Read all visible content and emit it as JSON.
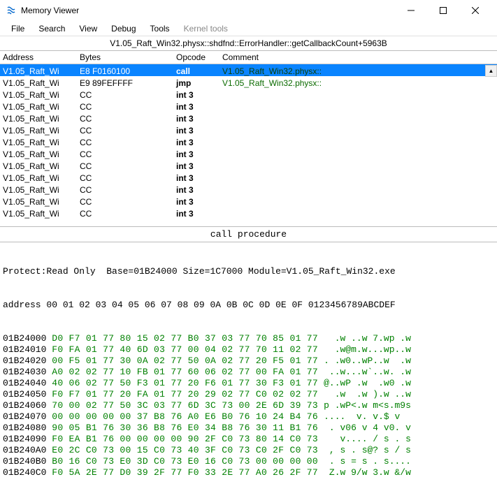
{
  "window": {
    "title": "Memory Viewer"
  },
  "menu": {
    "items": [
      "File",
      "Search",
      "View",
      "Debug",
      "Tools",
      "Kernel tools"
    ]
  },
  "context": "V1.05_Raft_Win32.physx::shdfnd::ErrorHandler::getCallbackCount+5963B",
  "headers": {
    "addr": "Address",
    "bytes": "Bytes",
    "op": "Opcode",
    "comment": "Comment"
  },
  "disasm": [
    {
      "addr": "V1.05_Raft_Wi",
      "bytes": "E8 F0160100",
      "op": "call",
      "comment": "V1.05_Raft_Win32.physx::",
      "selected": true
    },
    {
      "addr": "V1.05_Raft_Wi",
      "bytes": "E9 89FEFFFF",
      "op": "jmp",
      "comment": "V1.05_Raft_Win32.physx::",
      "selected": false
    },
    {
      "addr": "V1.05_Raft_Wi",
      "bytes": "CC",
      "op": "int 3",
      "comment": "",
      "selected": false
    },
    {
      "addr": "V1.05_Raft_Wi",
      "bytes": "CC",
      "op": "int 3",
      "comment": "",
      "selected": false
    },
    {
      "addr": "V1.05_Raft_Wi",
      "bytes": "CC",
      "op": "int 3",
      "comment": "",
      "selected": false
    },
    {
      "addr": "V1.05_Raft_Wi",
      "bytes": "CC",
      "op": "int 3",
      "comment": "",
      "selected": false
    },
    {
      "addr": "V1.05_Raft_Wi",
      "bytes": "CC",
      "op": "int 3",
      "comment": "",
      "selected": false
    },
    {
      "addr": "V1.05_Raft_Wi",
      "bytes": "CC",
      "op": "int 3",
      "comment": "",
      "selected": false
    },
    {
      "addr": "V1.05_Raft_Wi",
      "bytes": "CC",
      "op": "int 3",
      "comment": "",
      "selected": false
    },
    {
      "addr": "V1.05_Raft_Wi",
      "bytes": "CC",
      "op": "int 3",
      "comment": "",
      "selected": false
    },
    {
      "addr": "V1.05_Raft_Wi",
      "bytes": "CC",
      "op": "int 3",
      "comment": "",
      "selected": false
    },
    {
      "addr": "V1.05_Raft_Wi",
      "bytes": "CC",
      "op": "int 3",
      "comment": "",
      "selected": false
    },
    {
      "addr": "V1.05_Raft_Wi",
      "bytes": "CC",
      "op": "int 3",
      "comment": "",
      "selected": false
    }
  ],
  "status_bar": "call procedure",
  "hex": {
    "info": "Protect:Read Only  Base=01B24000 Size=1C7000 Module=V1.05_Raft_Win32.exe",
    "header_addr": "address",
    "header_cols": " 00 01 02 03 04 05 06 07 08 09 0A 0B 0C 0D 0E 0F 0123456789ABCDEF",
    "rows": [
      {
        "addr": "01B24000",
        "b": "D0 F7 01 77 80 15 02 77 B0 37 03 77 70 85 01 77",
        "a": "  .w ..w 7.wp .w"
      },
      {
        "addr": "01B24010",
        "b": "F0 FA 01 77 40 6D 03 77 00 04 02 77 70 11 02 77",
        "a": "  .w@m.w...wp..w"
      },
      {
        "addr": "01B24020",
        "b": "00 F5 01 77 30 0A 02 77 50 0A 02 77 20 F5 01 77",
        "a": ". .w0..wP..w  .w"
      },
      {
        "addr": "01B24030",
        "b": "A0 02 02 77 10 FB 01 77 60 06 02 77 00 FA 01 77",
        "a": " ..w...w`..w. .w"
      },
      {
        "addr": "01B24040",
        "b": "40 06 02 77 50 F3 01 77 20 F6 01 77 30 F3 01 77",
        "a": "@..wP .w  .w0 .w"
      },
      {
        "addr": "01B24050",
        "b": "F0 F7 01 77 20 FA 01 77 20 29 02 77 C0 02 02 77",
        "a": "  .w  .w ).w ..w"
      },
      {
        "addr": "01B24060",
        "b": "70 00 02 77 50 3C 03 77 6D 3C 73 00 2E 6D 39 73",
        "a": "p .wP<.w m<s.m9s"
      },
      {
        "addr": "01B24070",
        "b": "00 00 00 00 00 37 B8 76 A0 E6 B0 76 10 24 B4 76",
        "a": "....  v. v.$ v"
      },
      {
        "addr": "01B24080",
        "b": "90 05 B1 76 30 36 B8 76 E0 34 B8 76 30 11 B1 76",
        "a": " . v06 v 4 v0. v"
      },
      {
        "addr": "01B24090",
        "b": "F0 EA B1 76 00 00 00 00 90 2F C0 73 80 14 C0 73",
        "a": "   v.... / s . s"
      },
      {
        "addr": "01B240A0",
        "b": "E0 2C C0 73 00 15 C0 73 40 3F C0 73 C0 2F C0 73",
        "a": " , s . s@? s / s"
      },
      {
        "addr": "01B240B0",
        "b": "B0 16 C0 73 E0 3D C0 73 E0 16 C0 73 00 00 00 00",
        "a": " . s = s . s...."
      },
      {
        "addr": "01B240C0",
        "b": "F0 5A 2E 77 D0 39 2F 77 F0 33 2E 77 A0 26 2F 77",
        "a": " Z.w 9/w 3.w &/w"
      }
    ]
  }
}
